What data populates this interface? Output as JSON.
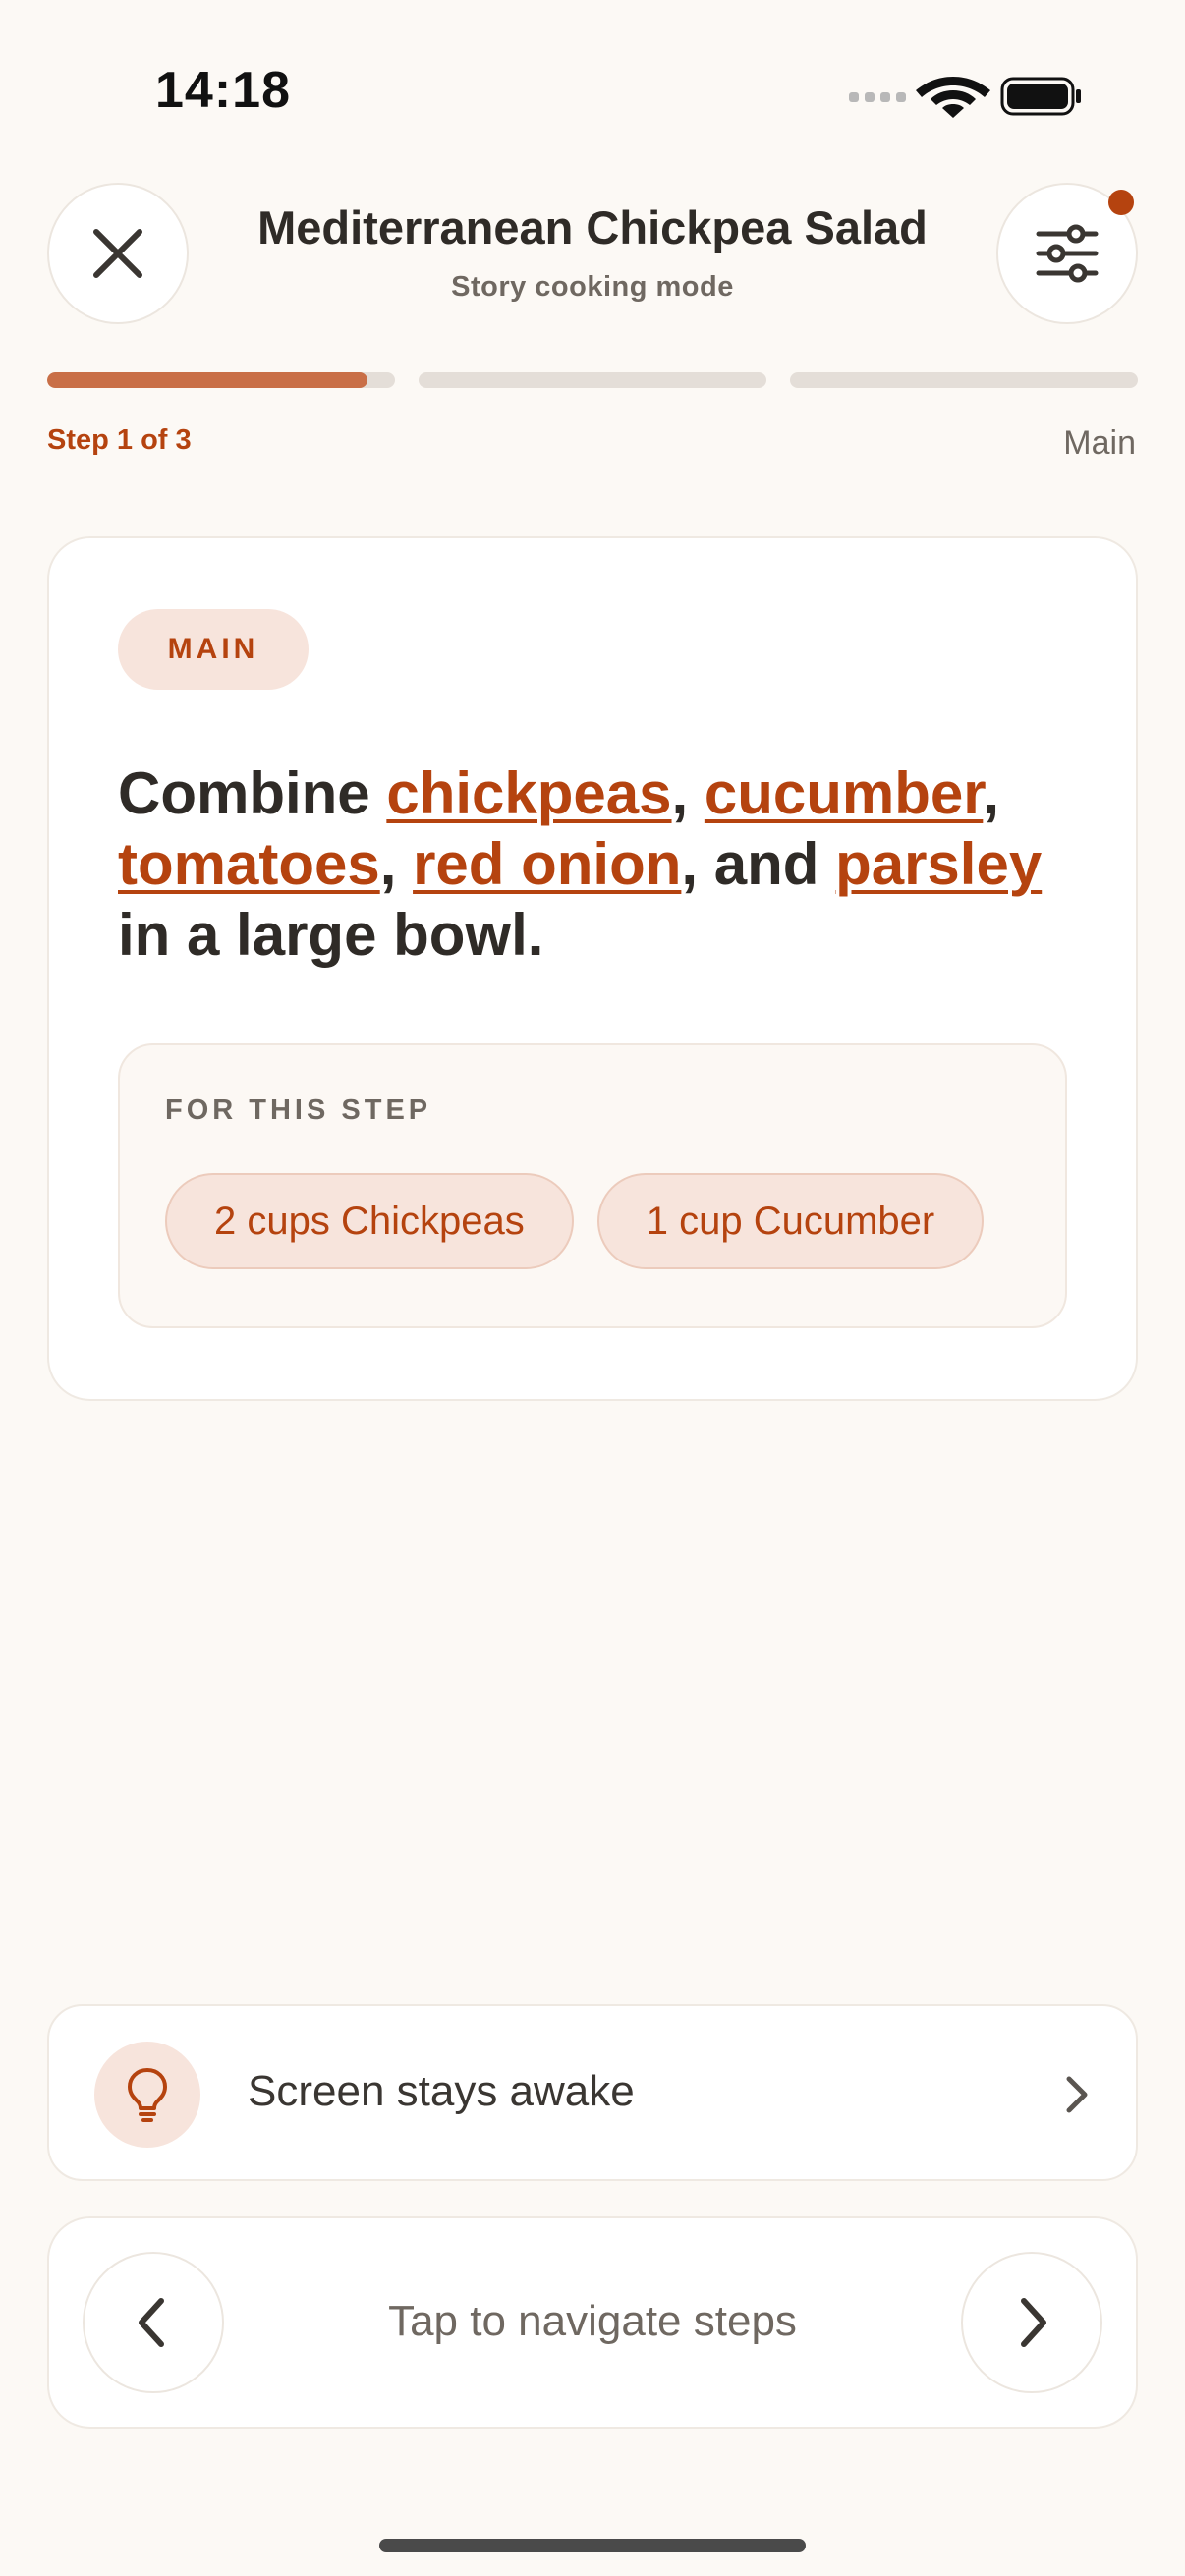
{
  "status_bar": {
    "time": "14:18"
  },
  "header": {
    "title": "Mediterranean Chickpea Salad",
    "subtitle": "Story cooking mode",
    "has_notification": true
  },
  "progress": {
    "segments": 3,
    "current_step": 1,
    "current_fill_fraction": 0.92,
    "step_label": "Step 1 of 3",
    "section_label": "Main"
  },
  "step_card": {
    "badge": "MAIN",
    "instruction": {
      "t0": "Combine ",
      "ing0": "chickpeas",
      "t1": ", ",
      "ing1": "cucumber",
      "t2": ", ",
      "ing2": "tomatoes",
      "t3": ", ",
      "ing3": "red onion",
      "t4": ", and ",
      "ing4": "parsley",
      "t5": " in a large bowl."
    },
    "for_this_step_label": "FOR THIS STEP",
    "chips": [
      "2 cups Chickpeas",
      "1 cup Cucumber"
    ]
  },
  "awake": {
    "text": "Screen stays awake"
  },
  "navigation": {
    "text": "Tap to navigate steps"
  },
  "colors": {
    "accent": "#b5430f",
    "progress_fill": "#c96f47",
    "background": "#fcf9f5",
    "chip_bg": "#f7e4dc"
  },
  "icons": {
    "close": "close-icon",
    "settings": "sliders-icon",
    "bulb": "lightbulb-icon",
    "prev": "chevron-left-icon",
    "next": "chevron-right-icon"
  }
}
